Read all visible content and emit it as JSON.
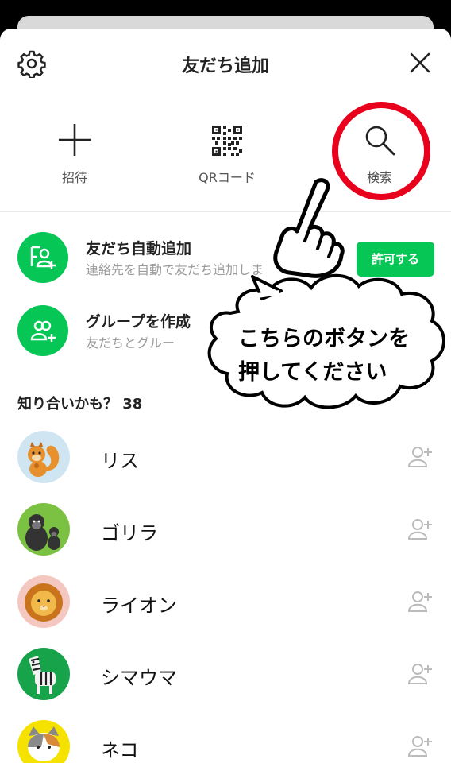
{
  "header": {
    "title": "友だち追加",
    "settings_icon": "gear-icon",
    "close_icon": "close-icon"
  },
  "actions": [
    {
      "label": "招待",
      "icon": "plus-icon"
    },
    {
      "label": "QRコード",
      "icon": "qr-code-icon"
    },
    {
      "label": "検索",
      "icon": "search-icon"
    }
  ],
  "features": {
    "auto_add": {
      "title": "友だち自動追加",
      "subtitle": "連絡先を自動で友だち追加しま",
      "button": "許可する"
    },
    "create_group": {
      "title": "グループを作成",
      "subtitle": "友だちとグルー"
    }
  },
  "suggestions": {
    "header": "知り合いかも？ 38",
    "friends": [
      {
        "name": "リス",
        "avatar": "squirrel"
      },
      {
        "name": "ゴリラ",
        "avatar": "gorilla"
      },
      {
        "name": "ライオン",
        "avatar": "lion"
      },
      {
        "name": "シマウマ",
        "avatar": "zebra"
      },
      {
        "name": "ネコ",
        "avatar": "cat"
      }
    ]
  },
  "annotation": {
    "line1": "こちらのボタンを",
    "line2": "押してください",
    "pointer_icon": "pointing-hand-icon"
  },
  "colors": {
    "brand_green": "#06c755",
    "highlight_red": "#e8001c"
  }
}
